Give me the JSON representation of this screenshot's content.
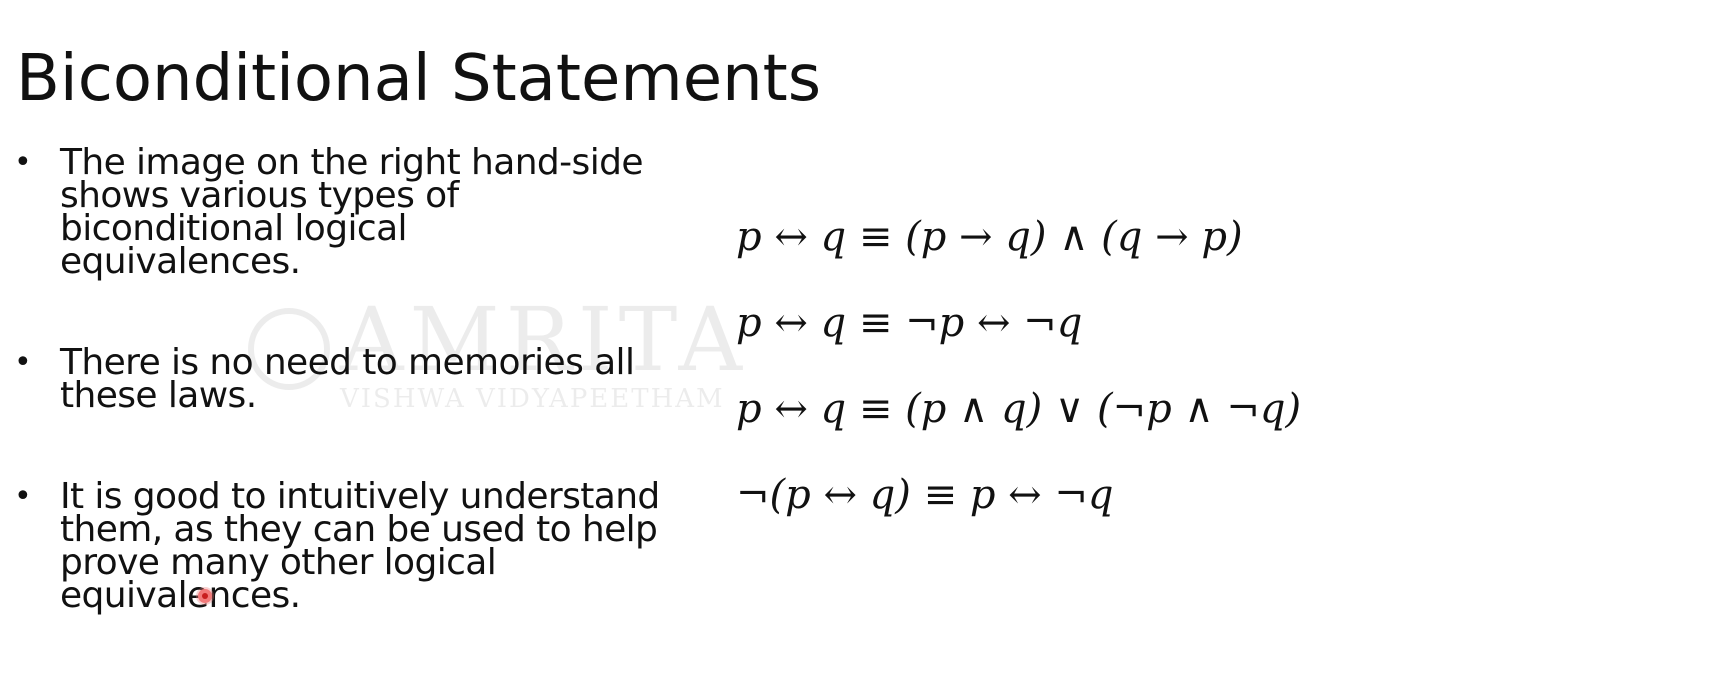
{
  "slide": {
    "title": "Biconditional Statements",
    "bullets": [
      "The image on the right hand-side shows various types of biconditional logical equivalences.",
      "There is no need to memories all these laws.",
      "It is good to intuitively understand them, as they can be used to help prove many other logical equivalences."
    ],
    "watermark": {
      "name": "AMRITA",
      "subtitle": "VISHWA VIDYAPEETHAM"
    }
  },
  "equations": [
    {
      "lhs": "p ↔ q",
      "rhs": "(p → q) ∧ (q → p)"
    },
    {
      "lhs": "p ↔ q",
      "rhs": "¬p ↔ ¬q"
    },
    {
      "lhs": "p ↔ q",
      "rhs": "(p ∧ q) ∨ (¬p ∧ ¬q)"
    },
    {
      "lhs": "¬(p ↔ q)",
      "rhs": "p ↔ ¬q"
    }
  ],
  "symbols": {
    "equiv": "≡"
  },
  "colors": {
    "text": "#111111",
    "background": "#ffffff",
    "pointer": "#c81e1e"
  }
}
